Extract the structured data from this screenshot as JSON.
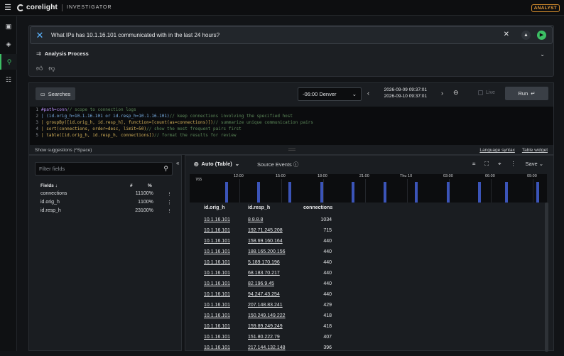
{
  "app": {
    "logo_text": "corelight",
    "product": "INVESTIGATOR",
    "role_badge": "ANALYST"
  },
  "sidenav": {
    "items": [
      {
        "name": "sidebar-item-dashboard",
        "icon": "panel-icon",
        "glyph": "▣"
      },
      {
        "name": "sidebar-item-layers",
        "icon": "layers-icon",
        "glyph": "◈"
      },
      {
        "name": "sidebar-item-search",
        "icon": "binoculars-icon",
        "glyph": "⚲"
      },
      {
        "name": "sidebar-item-settings",
        "icon": "sliders-icon",
        "glyph": "☷"
      }
    ],
    "active_index": 2
  },
  "chat": {
    "question": "What IPs has 10.1.16.101 communicated with in the last 24 hours?",
    "analysis_label": "Analysis Process"
  },
  "query": {
    "searches_label": "Searches",
    "timezone": "-06:00 Denver",
    "time_start": "2026-09-09 09:37:01",
    "time_end": "2026-09-10 09:37:01",
    "live_label": "Live",
    "run_label": "Run",
    "suggestions": "Show suggestions (^Space)",
    "language_syntax": "Language syntax",
    "table_widget": "Table widget",
    "lines": [
      {
        "n": "1",
        "code": "#path=conn",
        "comment": " // scope to connection logs"
      },
      {
        "n": "2",
        "code": "| (id.orig_h=10.1.16.101 or id.resp_h=10.1.16.101)",
        "comment": " // keep connections involving the specified host"
      },
      {
        "n": "3",
        "code": "| groupBy([id.orig_h, id.resp_h], function=[count(as=connections)])",
        "comment": " // summarize unique communication pairs"
      },
      {
        "n": "4",
        "code": "| sort(connections, order=desc, limit=50)",
        "comment": " // show the most frequent pairs first"
      },
      {
        "n": "5",
        "code": "| table([id.orig_h, id.resp_h, connections])",
        "comment": " // format the results for review"
      }
    ]
  },
  "fields": {
    "filter_placeholder": "Filter fields",
    "header_fields": "Fields ↓",
    "header_count": "#",
    "header_pct": "%",
    "rows": [
      {
        "name": "connections",
        "count": "11",
        "pct": "100%"
      },
      {
        "name": "id.orig_h",
        "count": "1",
        "pct": "100%"
      },
      {
        "name": "id.resp_h",
        "count": "23",
        "pct": "100%"
      }
    ]
  },
  "results": {
    "tab_auto": "Auto (Table)",
    "tab_source": "Source Events",
    "save_label": "Save",
    "histogram": {
      "max_label": "765",
      "ticks": [
        "12:00",
        "15:00",
        "18:00",
        "21:00",
        "Thu 10",
        "03:00",
        "06:00",
        "09:00"
      ]
    },
    "columns": [
      "id.orig_h",
      "id.resp_h",
      "connections"
    ],
    "rows": [
      [
        "10.1.16.101",
        "8.8.8.8",
        "1034"
      ],
      [
        "10.1.16.101",
        "192.71.245.208",
        "715"
      ],
      [
        "10.1.16.101",
        "158.69.160.164",
        "440"
      ],
      [
        "10.1.16.101",
        "188.165.200.156",
        "440"
      ],
      [
        "10.1.16.101",
        "5.189.170.196",
        "440"
      ],
      [
        "10.1.16.101",
        "68.183.70.217",
        "440"
      ],
      [
        "10.1.16.101",
        "82.196.9.45",
        "440"
      ],
      [
        "10.1.16.101",
        "94.247.43.254",
        "440"
      ],
      [
        "10.1.16.101",
        "207.148.83.241",
        "429"
      ],
      [
        "10.1.16.101",
        "150.249.149.222",
        "418"
      ],
      [
        "10.1.16.101",
        "159.89.249.249",
        "418"
      ],
      [
        "10.1.16.101",
        "151.80.222.79",
        "407"
      ],
      [
        "10.1.16.101",
        "217.144.132.148",
        "396"
      ]
    ]
  },
  "colors": {
    "accent_green": "#3cbf64",
    "histogram_bar": "#3b54b8",
    "badge_orange": "#e59b3a"
  }
}
